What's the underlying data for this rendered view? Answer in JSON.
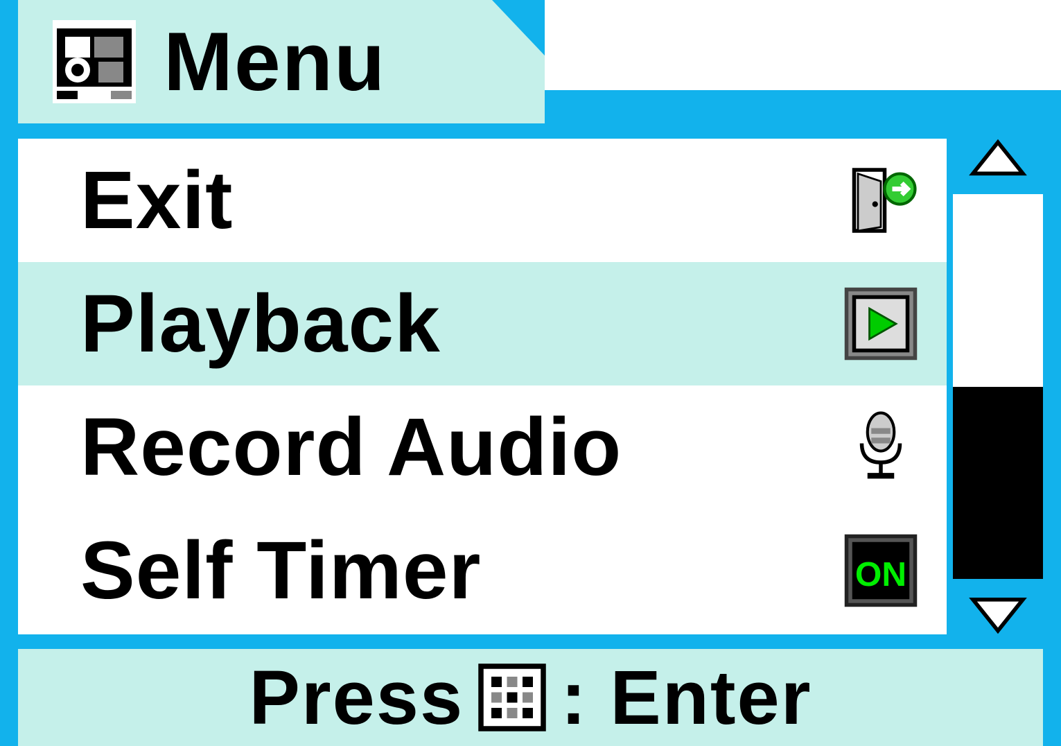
{
  "header": {
    "title": "Menu"
  },
  "menu": {
    "items": [
      {
        "label": "Exit",
        "icon": "exit-icon",
        "selected": false
      },
      {
        "label": "Playback",
        "icon": "playback-icon",
        "selected": true
      },
      {
        "label": "Record Audio",
        "icon": "microphone-icon",
        "selected": false
      },
      {
        "label": "Self Timer",
        "icon": "on-icon",
        "selected": false
      }
    ]
  },
  "footer": {
    "press_label": "Press",
    "enter_label": ": Enter"
  },
  "scrollbar": {
    "position": "bottom"
  }
}
